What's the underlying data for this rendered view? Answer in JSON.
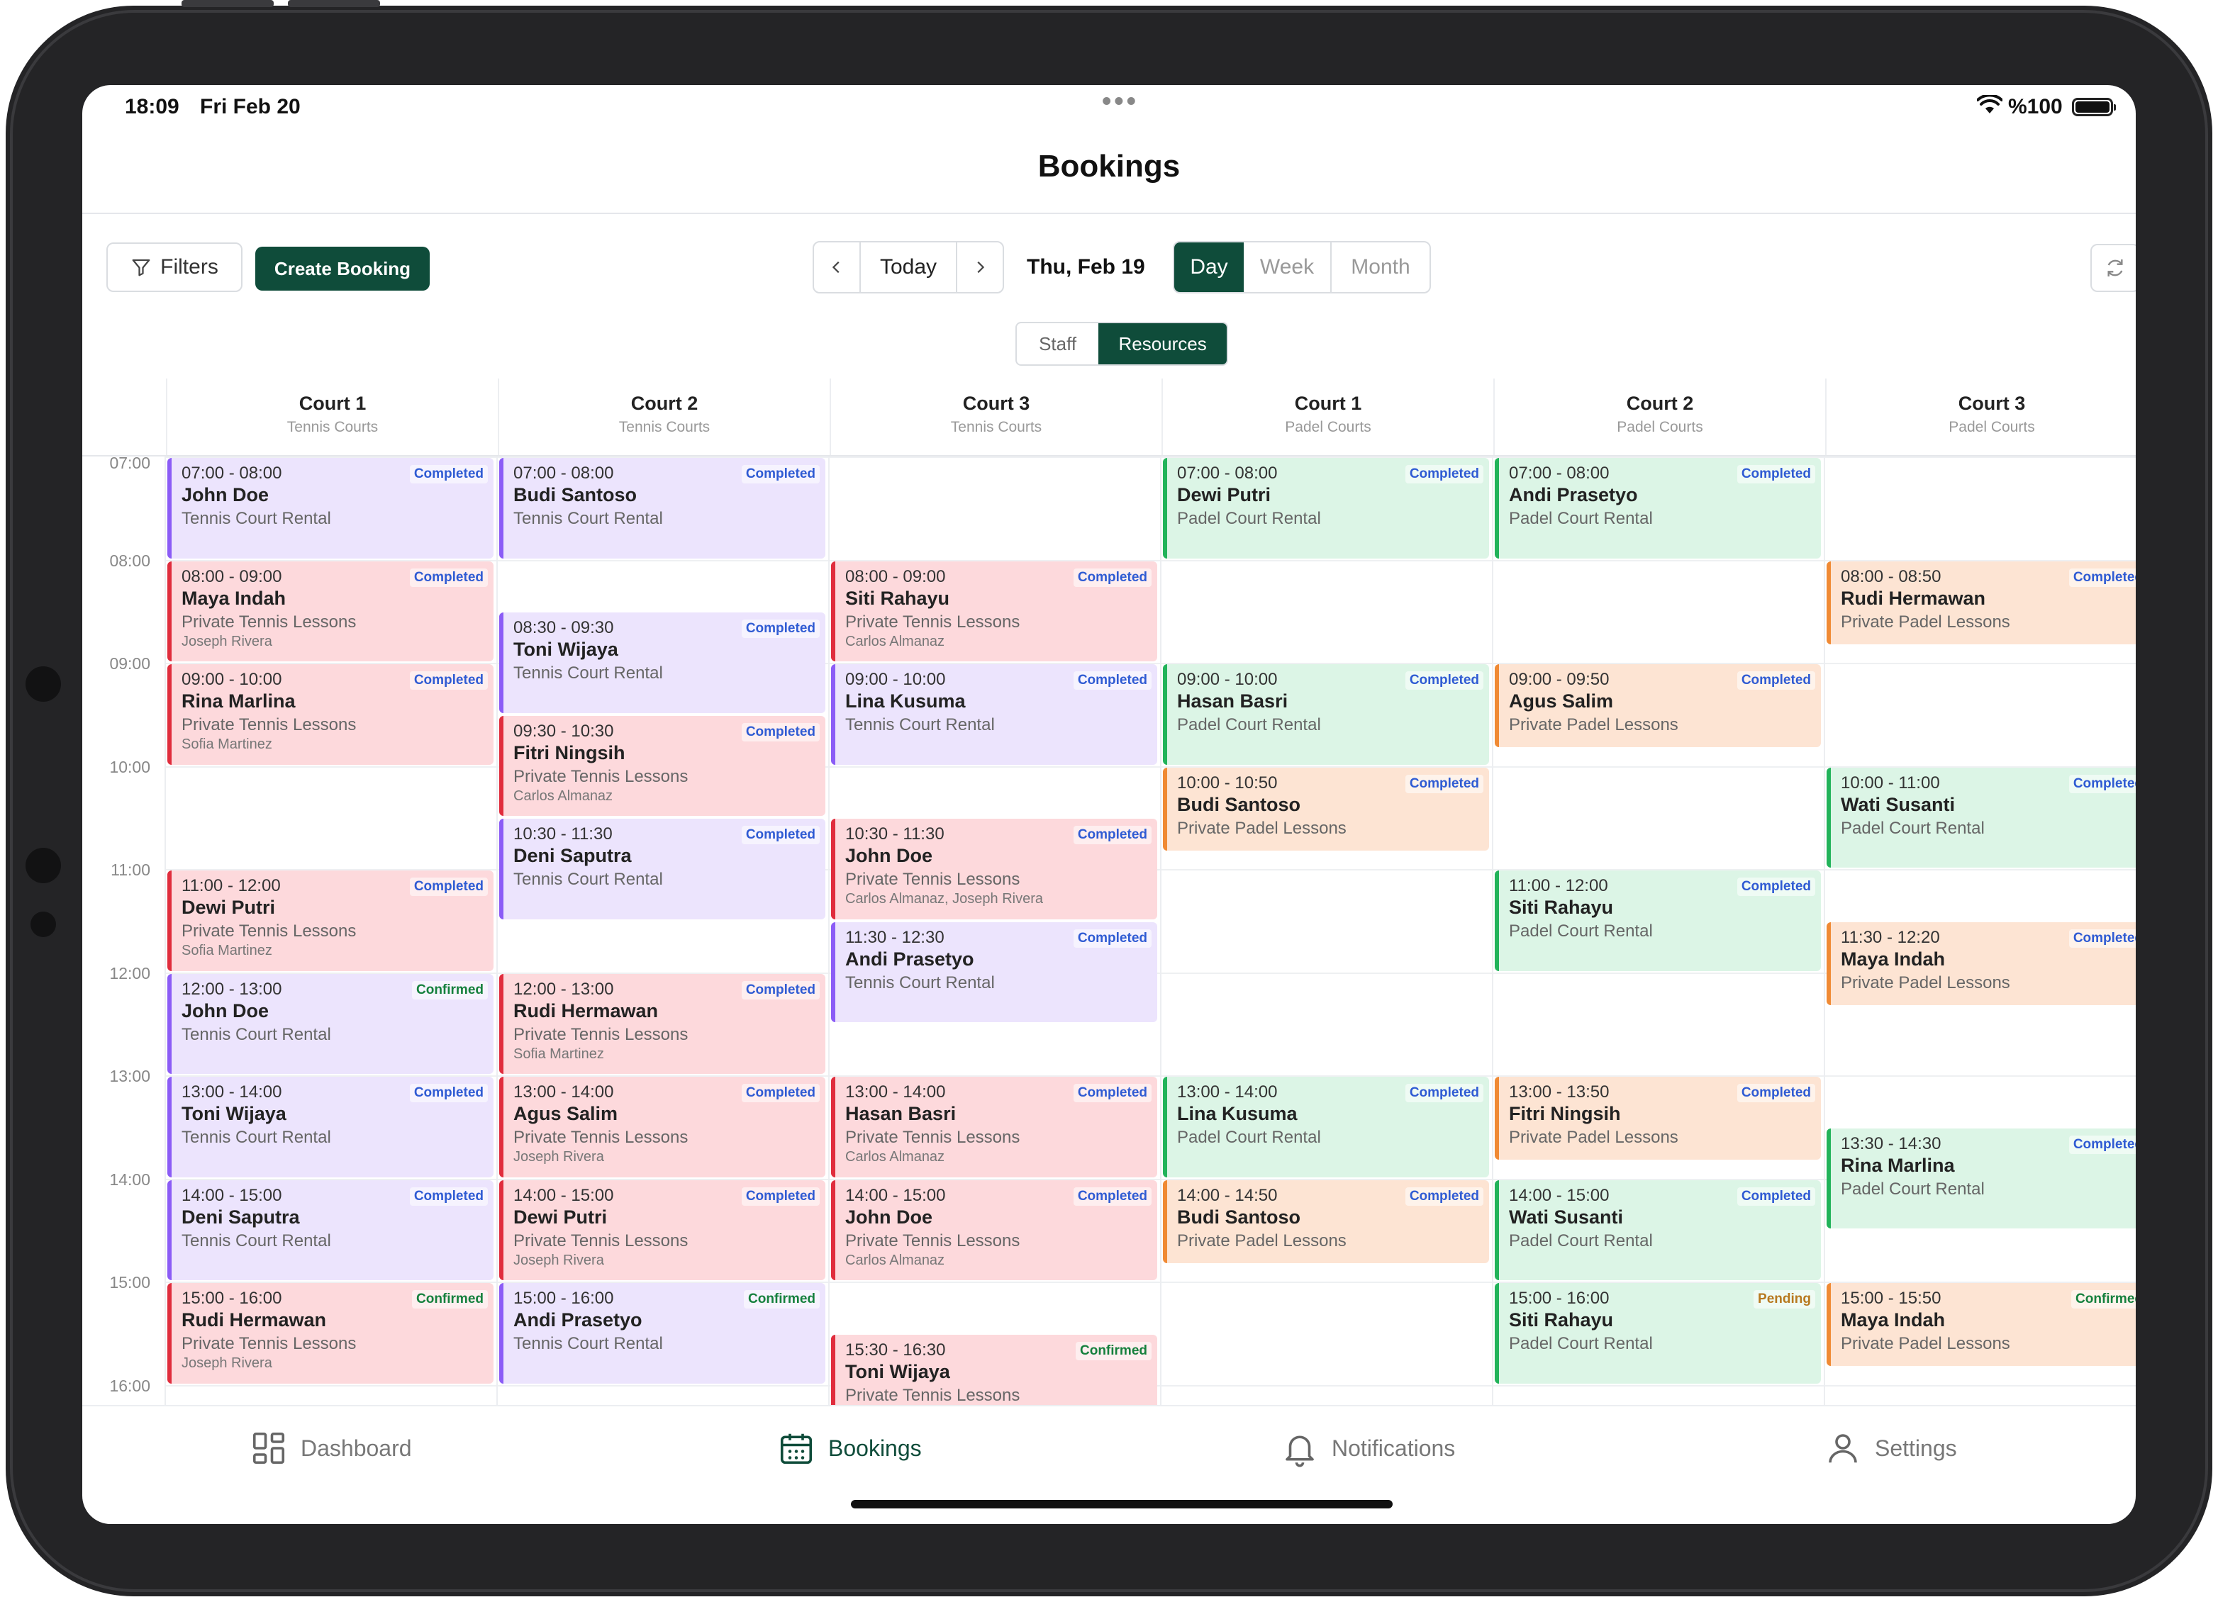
{
  "status": {
    "time": "18:09",
    "date": "Fri Feb 20",
    "battery": "%100"
  },
  "header": {
    "title": "Bookings"
  },
  "toolbar": {
    "filters_label": "Filters",
    "create_label": "Create Booking",
    "today_label": "Today",
    "current_date": "Thu, Feb 19",
    "views": [
      "Day",
      "Week",
      "Month"
    ],
    "active_view": "Day",
    "modes": [
      "Staff",
      "Resources"
    ],
    "active_mode": "Resources"
  },
  "colors": {
    "primary": "#0f4c3a",
    "purple_bg": "#ece4fd",
    "purple_border": "#8b5cf6",
    "red_bg": "#fdd9dc",
    "red_border": "#e02d3d",
    "green_bg": "#dcf5e6",
    "green_border": "#22b35a",
    "orange_bg": "#fde4d3",
    "orange_border": "#f08a34"
  },
  "times": [
    "07:00",
    "08:00",
    "09:00",
    "10:00",
    "11:00",
    "12:00",
    "13:00",
    "14:00",
    "15:00",
    "16:00"
  ],
  "columns": [
    {
      "name": "Court 1",
      "sub": "Tennis Courts",
      "events": [
        {
          "time": "07:00 - 08:00",
          "start": 7.0,
          "end": 8.0,
          "name": "John Doe",
          "service": "Tennis Court Rental",
          "staff": "",
          "status": "Completed",
          "color": "purple"
        },
        {
          "time": "08:00 - 09:00",
          "start": 8.0,
          "end": 9.0,
          "name": "Maya Indah",
          "service": "Private Tennis Lessons",
          "staff": "Joseph Rivera",
          "status": "Completed",
          "color": "red"
        },
        {
          "time": "09:00 - 10:00",
          "start": 9.0,
          "end": 10.0,
          "name": "Rina Marlina",
          "service": "Private Tennis Lessons",
          "staff": "Sofia Martinez",
          "status": "Completed",
          "color": "red"
        },
        {
          "time": "11:00 - 12:00",
          "start": 11.0,
          "end": 12.0,
          "name": "Dewi Putri",
          "service": "Private Tennis Lessons",
          "staff": "Sofia Martinez",
          "status": "Completed",
          "color": "red"
        },
        {
          "time": "12:00 - 13:00",
          "start": 12.0,
          "end": 13.0,
          "name": "John Doe",
          "service": "Tennis Court Rental",
          "staff": "",
          "status": "Confirmed",
          "color": "purple"
        },
        {
          "time": "13:00 - 14:00",
          "start": 13.0,
          "end": 14.0,
          "name": "Toni Wijaya",
          "service": "Tennis Court Rental",
          "staff": "",
          "status": "Completed",
          "color": "purple"
        },
        {
          "time": "14:00 - 15:00",
          "start": 14.0,
          "end": 15.0,
          "name": "Deni Saputra",
          "service": "Tennis Court Rental",
          "staff": "",
          "status": "Completed",
          "color": "purple"
        },
        {
          "time": "15:00 - 16:00",
          "start": 15.0,
          "end": 16.0,
          "name": "Rudi Hermawan",
          "service": "Private Tennis Lessons",
          "staff": "Joseph Rivera",
          "status": "Confirmed",
          "color": "red"
        }
      ]
    },
    {
      "name": "Court 2",
      "sub": "Tennis Courts",
      "events": [
        {
          "time": "07:00 - 08:00",
          "start": 7.0,
          "end": 8.0,
          "name": "Budi Santoso",
          "service": "Tennis Court Rental",
          "staff": "",
          "status": "Completed",
          "color": "purple"
        },
        {
          "time": "08:30 - 09:30",
          "start": 8.5,
          "end": 9.5,
          "name": "Toni Wijaya",
          "service": "Tennis Court Rental",
          "staff": "",
          "status": "Completed",
          "color": "purple"
        },
        {
          "time": "09:30 - 10:30",
          "start": 9.5,
          "end": 10.5,
          "name": "Fitri Ningsih",
          "service": "Private Tennis Lessons",
          "staff": "Carlos Almanaz",
          "status": "Completed",
          "color": "red"
        },
        {
          "time": "10:30 - 11:30",
          "start": 10.5,
          "end": 11.5,
          "name": "Deni Saputra",
          "service": "Tennis Court Rental",
          "staff": "",
          "status": "Completed",
          "color": "purple"
        },
        {
          "time": "12:00 - 13:00",
          "start": 12.0,
          "end": 13.0,
          "name": "Rudi Hermawan",
          "service": "Private Tennis Lessons",
          "staff": "Sofia Martinez",
          "status": "Completed",
          "color": "red"
        },
        {
          "time": "13:00 - 14:00",
          "start": 13.0,
          "end": 14.0,
          "name": "Agus Salim",
          "service": "Private Tennis Lessons",
          "staff": "Joseph Rivera",
          "status": "Completed",
          "color": "red"
        },
        {
          "time": "14:00 - 15:00",
          "start": 14.0,
          "end": 15.0,
          "name": "Dewi Putri",
          "service": "Private Tennis Lessons",
          "staff": "Joseph Rivera",
          "status": "Completed",
          "color": "red"
        },
        {
          "time": "15:00 - 16:00",
          "start": 15.0,
          "end": 16.0,
          "name": "Andi Prasetyo",
          "service": "Tennis Court Rental",
          "staff": "",
          "status": "Confirmed",
          "color": "purple"
        }
      ]
    },
    {
      "name": "Court 3",
      "sub": "Tennis Courts",
      "events": [
        {
          "time": "08:00 - 09:00",
          "start": 8.0,
          "end": 9.0,
          "name": "Siti Rahayu",
          "service": "Private Tennis Lessons",
          "staff": "Carlos Almanaz",
          "status": "Completed",
          "color": "red"
        },
        {
          "time": "09:00 - 10:00",
          "start": 9.0,
          "end": 10.0,
          "name": "Lina Kusuma",
          "service": "Tennis Court Rental",
          "staff": "",
          "status": "Completed",
          "color": "purple"
        },
        {
          "time": "10:30 - 11:30",
          "start": 10.5,
          "end": 11.5,
          "name": "John Doe",
          "service": "Private Tennis Lessons",
          "staff": "Carlos Almanaz, Joseph Rivera",
          "status": "Completed",
          "color": "red"
        },
        {
          "time": "11:30 - 12:30",
          "start": 11.5,
          "end": 12.5,
          "name": "Andi Prasetyo",
          "service": "Tennis Court Rental",
          "staff": "",
          "status": "Completed",
          "color": "purple"
        },
        {
          "time": "13:00 - 14:00",
          "start": 13.0,
          "end": 14.0,
          "name": "Hasan Basri",
          "service": "Private Tennis Lessons",
          "staff": "Carlos Almanaz",
          "status": "Completed",
          "color": "red"
        },
        {
          "time": "14:00 - 15:00",
          "start": 14.0,
          "end": 15.0,
          "name": "John Doe",
          "service": "Private Tennis Lessons",
          "staff": "Carlos Almanaz",
          "status": "Completed",
          "color": "red"
        },
        {
          "time": "15:30 - 16:30",
          "start": 15.5,
          "end": 16.5,
          "name": "Toni Wijaya",
          "service": "Private Tennis Lessons",
          "staff": "",
          "status": "Confirmed",
          "color": "red"
        }
      ]
    },
    {
      "name": "Court 1",
      "sub": "Padel Courts",
      "events": [
        {
          "time": "07:00 - 08:00",
          "start": 7.0,
          "end": 8.0,
          "name": "Dewi Putri",
          "service": "Padel Court Rental",
          "staff": "",
          "status": "Completed",
          "color": "green"
        },
        {
          "time": "09:00 - 10:00",
          "start": 9.0,
          "end": 10.0,
          "name": "Hasan Basri",
          "service": "Padel Court Rental",
          "staff": "",
          "status": "Completed",
          "color": "green"
        },
        {
          "time": "10:00 - 10:50",
          "start": 10.0,
          "end": 10.8333,
          "name": "Budi Santoso",
          "service": "Private Padel Lessons",
          "staff": "",
          "status": "Completed",
          "color": "orange"
        },
        {
          "time": "13:00 - 14:00",
          "start": 13.0,
          "end": 14.0,
          "name": "Lina Kusuma",
          "service": "Padel Court Rental",
          "staff": "",
          "status": "Completed",
          "color": "green"
        },
        {
          "time": "14:00 - 14:50",
          "start": 14.0,
          "end": 14.8333,
          "name": "Budi Santoso",
          "service": "Private Padel Lessons",
          "staff": "",
          "status": "Completed",
          "color": "orange"
        }
      ]
    },
    {
      "name": "Court 2",
      "sub": "Padel Courts",
      "events": [
        {
          "time": "07:00 - 08:00",
          "start": 7.0,
          "end": 8.0,
          "name": "Andi Prasetyo",
          "service": "Padel Court Rental",
          "staff": "",
          "status": "Completed",
          "color": "green"
        },
        {
          "time": "09:00 - 09:50",
          "start": 9.0,
          "end": 9.8333,
          "name": "Agus Salim",
          "service": "Private Padel Lessons",
          "staff": "",
          "status": "Completed",
          "color": "orange"
        },
        {
          "time": "11:00 - 12:00",
          "start": 11.0,
          "end": 12.0,
          "name": "Siti Rahayu",
          "service": "Padel Court Rental",
          "staff": "",
          "status": "Completed",
          "color": "green"
        },
        {
          "time": "13:00 - 13:50",
          "start": 13.0,
          "end": 13.8333,
          "name": "Fitri Ningsih",
          "service": "Private Padel Lessons",
          "staff": "",
          "status": "Completed",
          "color": "orange"
        },
        {
          "time": "14:00 - 15:00",
          "start": 14.0,
          "end": 15.0,
          "name": "Wati Susanti",
          "service": "Padel Court Rental",
          "staff": "",
          "status": "Completed",
          "color": "green"
        },
        {
          "time": "15:00 - 16:00",
          "start": 15.0,
          "end": 16.0,
          "name": "Siti Rahayu",
          "service": "Padel Court Rental",
          "staff": "",
          "status": "Pending",
          "color": "green"
        }
      ]
    },
    {
      "name": "Court 3",
      "sub": "Padel Courts",
      "events": [
        {
          "time": "08:00 - 08:50",
          "start": 8.0,
          "end": 8.8333,
          "name": "Rudi Hermawan",
          "service": "Private Padel Lessons",
          "staff": "",
          "status": "Completed",
          "color": "orange"
        },
        {
          "time": "10:00 - 11:00",
          "start": 10.0,
          "end": 11.0,
          "name": "Wati Susanti",
          "service": "Padel Court Rental",
          "staff": "",
          "status": "Completed",
          "color": "green"
        },
        {
          "time": "11:30 - 12:20",
          "start": 11.5,
          "end": 12.3333,
          "name": "Maya Indah",
          "service": "Private Padel Lessons",
          "staff": "",
          "status": "Completed",
          "color": "orange"
        },
        {
          "time": "13:30 - 14:30",
          "start": 13.5,
          "end": 14.5,
          "name": "Rina Marlina",
          "service": "Padel Court Rental",
          "staff": "",
          "status": "Completed",
          "color": "green"
        },
        {
          "time": "15:00 - 15:50",
          "start": 15.0,
          "end": 15.8333,
          "name": "Maya Indah",
          "service": "Private Padel Lessons",
          "staff": "",
          "status": "Confirmed",
          "color": "orange"
        }
      ]
    }
  ],
  "tabbar": [
    {
      "label": "Dashboard",
      "icon": "dashboard-icon",
      "active": false
    },
    {
      "label": "Bookings",
      "icon": "calendar-icon",
      "active": true
    },
    {
      "label": "Notifications",
      "icon": "bell-icon",
      "active": false
    },
    {
      "label": "Settings",
      "icon": "user-icon",
      "active": false
    }
  ]
}
